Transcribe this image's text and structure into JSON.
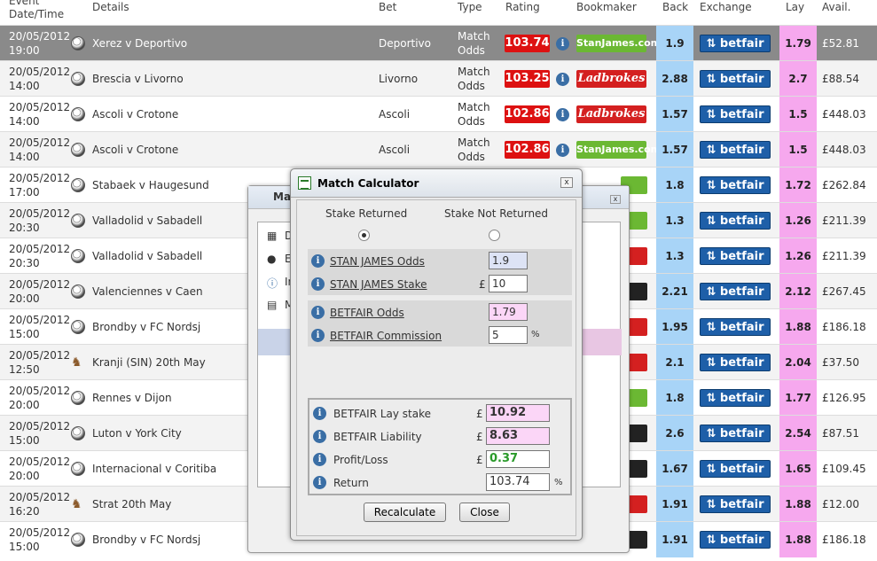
{
  "header": {
    "event": "Event",
    "datetime": "Date/Time",
    "details": "Details",
    "bet": "Bet",
    "type": "Type",
    "rating": "Rating",
    "bookmaker": "Bookmaker",
    "back": "Back",
    "exchange": "Exchange",
    "lay": "Lay",
    "avail": "Avail."
  },
  "rows": [
    {
      "date": "20/05/2012",
      "time": "19:00",
      "details": "Xerez v Deportivo",
      "bet": "Deportivo",
      "type1": "Match",
      "type2": "Odds",
      "rating": "103.74",
      "bookmaker": "StanJames.com",
      "back": "1.9",
      "exchange": "betfair",
      "lay": "1.79",
      "avail": "£52.81"
    },
    {
      "date": "20/05/2012",
      "time": "14:00",
      "details": "Brescia v Livorno",
      "bet": "Livorno",
      "type1": "Match",
      "type2": "Odds",
      "rating": "103.25",
      "bookmaker": "Ladbrokes",
      "back": "2.88",
      "exchange": "betfair",
      "lay": "2.7",
      "avail": "£88.54"
    },
    {
      "date": "20/05/2012",
      "time": "14:00",
      "details": "Ascoli v Crotone",
      "bet": "Ascoli",
      "type1": "Match",
      "type2": "Odds",
      "rating": "102.86",
      "bookmaker": "Ladbrokes",
      "back": "1.57",
      "exchange": "betfair",
      "lay": "1.5",
      "avail": "£448.03"
    },
    {
      "date": "20/05/2012",
      "time": "14:00",
      "details": "Ascoli v Crotone",
      "bet": "Ascoli",
      "type1": "Match",
      "type2": "Odds",
      "rating": "102.86",
      "bookmaker": "StanJames.com",
      "back": "1.57",
      "exchange": "betfair",
      "lay": "1.5",
      "avail": "£448.03"
    },
    {
      "date": "20/05/2012",
      "time": "17:00",
      "details": "Stabaek v Haugesund",
      "bet": "",
      "type1": "",
      "type2": "",
      "rating": "",
      "bookmaker": "",
      "back": "1.8",
      "exchange": "betfair",
      "lay": "1.72",
      "avail": "£262.84"
    },
    {
      "date": "20/05/2012",
      "time": "20:30",
      "details": "Valladolid v Sabadell",
      "bet": "",
      "type1": "",
      "type2": "",
      "rating": "",
      "bookmaker": "",
      "back": "1.3",
      "exchange": "betfair",
      "lay": "1.26",
      "avail": "£211.39"
    },
    {
      "date": "20/05/2012",
      "time": "20:30",
      "details": "Valladolid v Sabadell",
      "bet": "",
      "type1": "",
      "type2": "",
      "rating": "",
      "bookmaker": "",
      "back": "1.3",
      "exchange": "betfair",
      "lay": "1.26",
      "avail": "£211.39"
    },
    {
      "date": "20/05/2012",
      "time": "20:00",
      "details": "Valenciennes v Caen",
      "bet": "",
      "type1": "",
      "type2": "",
      "rating": "",
      "bookmaker": "",
      "back": "2.21",
      "exchange": "betfair",
      "lay": "2.12",
      "avail": "£267.45"
    },
    {
      "date": "20/05/2012",
      "time": "15:00",
      "details": "Brondby v FC Nordsj",
      "bet": "",
      "type1": "",
      "type2": "",
      "rating": "",
      "bookmaker": "",
      "back": "1.95",
      "exchange": "betfair",
      "lay": "1.88",
      "avail": "£186.18"
    },
    {
      "date": "20/05/2012",
      "time": "12:50",
      "details": "Kranji (SIN) 20th May",
      "bet": "",
      "type1": "",
      "type2": "",
      "rating": "",
      "bookmaker": "",
      "back": "2.1",
      "exchange": "betfair",
      "lay": "2.04",
      "avail": "£37.50"
    },
    {
      "date": "20/05/2012",
      "time": "20:00",
      "details": "Rennes v Dijon",
      "bet": "",
      "type1": "",
      "type2": "",
      "rating": "",
      "bookmaker": "",
      "back": "1.8",
      "exchange": "betfair",
      "lay": "1.77",
      "avail": "£126.95"
    },
    {
      "date": "20/05/2012",
      "time": "15:00",
      "details": "Luton v York City",
      "bet": "",
      "type1": "",
      "type2": "",
      "rating": "",
      "bookmaker": "",
      "back": "2.6",
      "exchange": "betfair",
      "lay": "2.54",
      "avail": "£87.51"
    },
    {
      "date": "20/05/2012",
      "time": "20:00",
      "details": "Internacional v Coritiba",
      "bet": "",
      "type1": "",
      "type2": "",
      "rating": "",
      "bookmaker": "",
      "back": "1.67",
      "exchange": "betfair",
      "lay": "1.65",
      "avail": "£109.45"
    },
    {
      "date": "20/05/2012",
      "time": "16:20",
      "details": "Strat 20th May",
      "bet": "",
      "type1": "",
      "type2": "",
      "rating": "",
      "bookmaker": "",
      "back": "1.91",
      "exchange": "betfair",
      "lay": "1.88",
      "avail": "£12.00"
    },
    {
      "date": "20/05/2012",
      "time": "15:00",
      "details": "Brondby v FC Nordsj",
      "bet": "",
      "type1": "",
      "type2": "",
      "rating": "",
      "bookmaker": "",
      "back": "1.91",
      "exchange": "betfair",
      "lay": "1.88",
      "avail": "£186.18"
    }
  ],
  "bg_window": {
    "title": "Ma",
    "items": [
      "D",
      "E",
      "In",
      "M"
    ]
  },
  "calc": {
    "title": "Match Calculator",
    "close_x": "x",
    "stake_returned": "Stake Returned",
    "stake_not_returned": "Stake Not Returned",
    "sj_odds_label": "STAN JAMES Odds",
    "sj_odds": "1.9",
    "sj_stake_label": "STAN JAMES Stake",
    "sj_stake": "10",
    "bf_odds_label": "BETFAIR Odds",
    "bf_odds": "1.79",
    "bf_comm_label": "BETFAIR Commission",
    "bf_comm": "5",
    "lay_stake_label": "BETFAIR Lay stake",
    "lay_stake": "10.92",
    "liability_label": "BETFAIR Liability",
    "liability": "8.63",
    "pl_label": "Profit/Loss",
    "pl": "0.37",
    "return_label": "Return",
    "return": "103.74",
    "pound": "£",
    "pct": "%",
    "recalculate": "Recalculate",
    "close": "Close"
  }
}
